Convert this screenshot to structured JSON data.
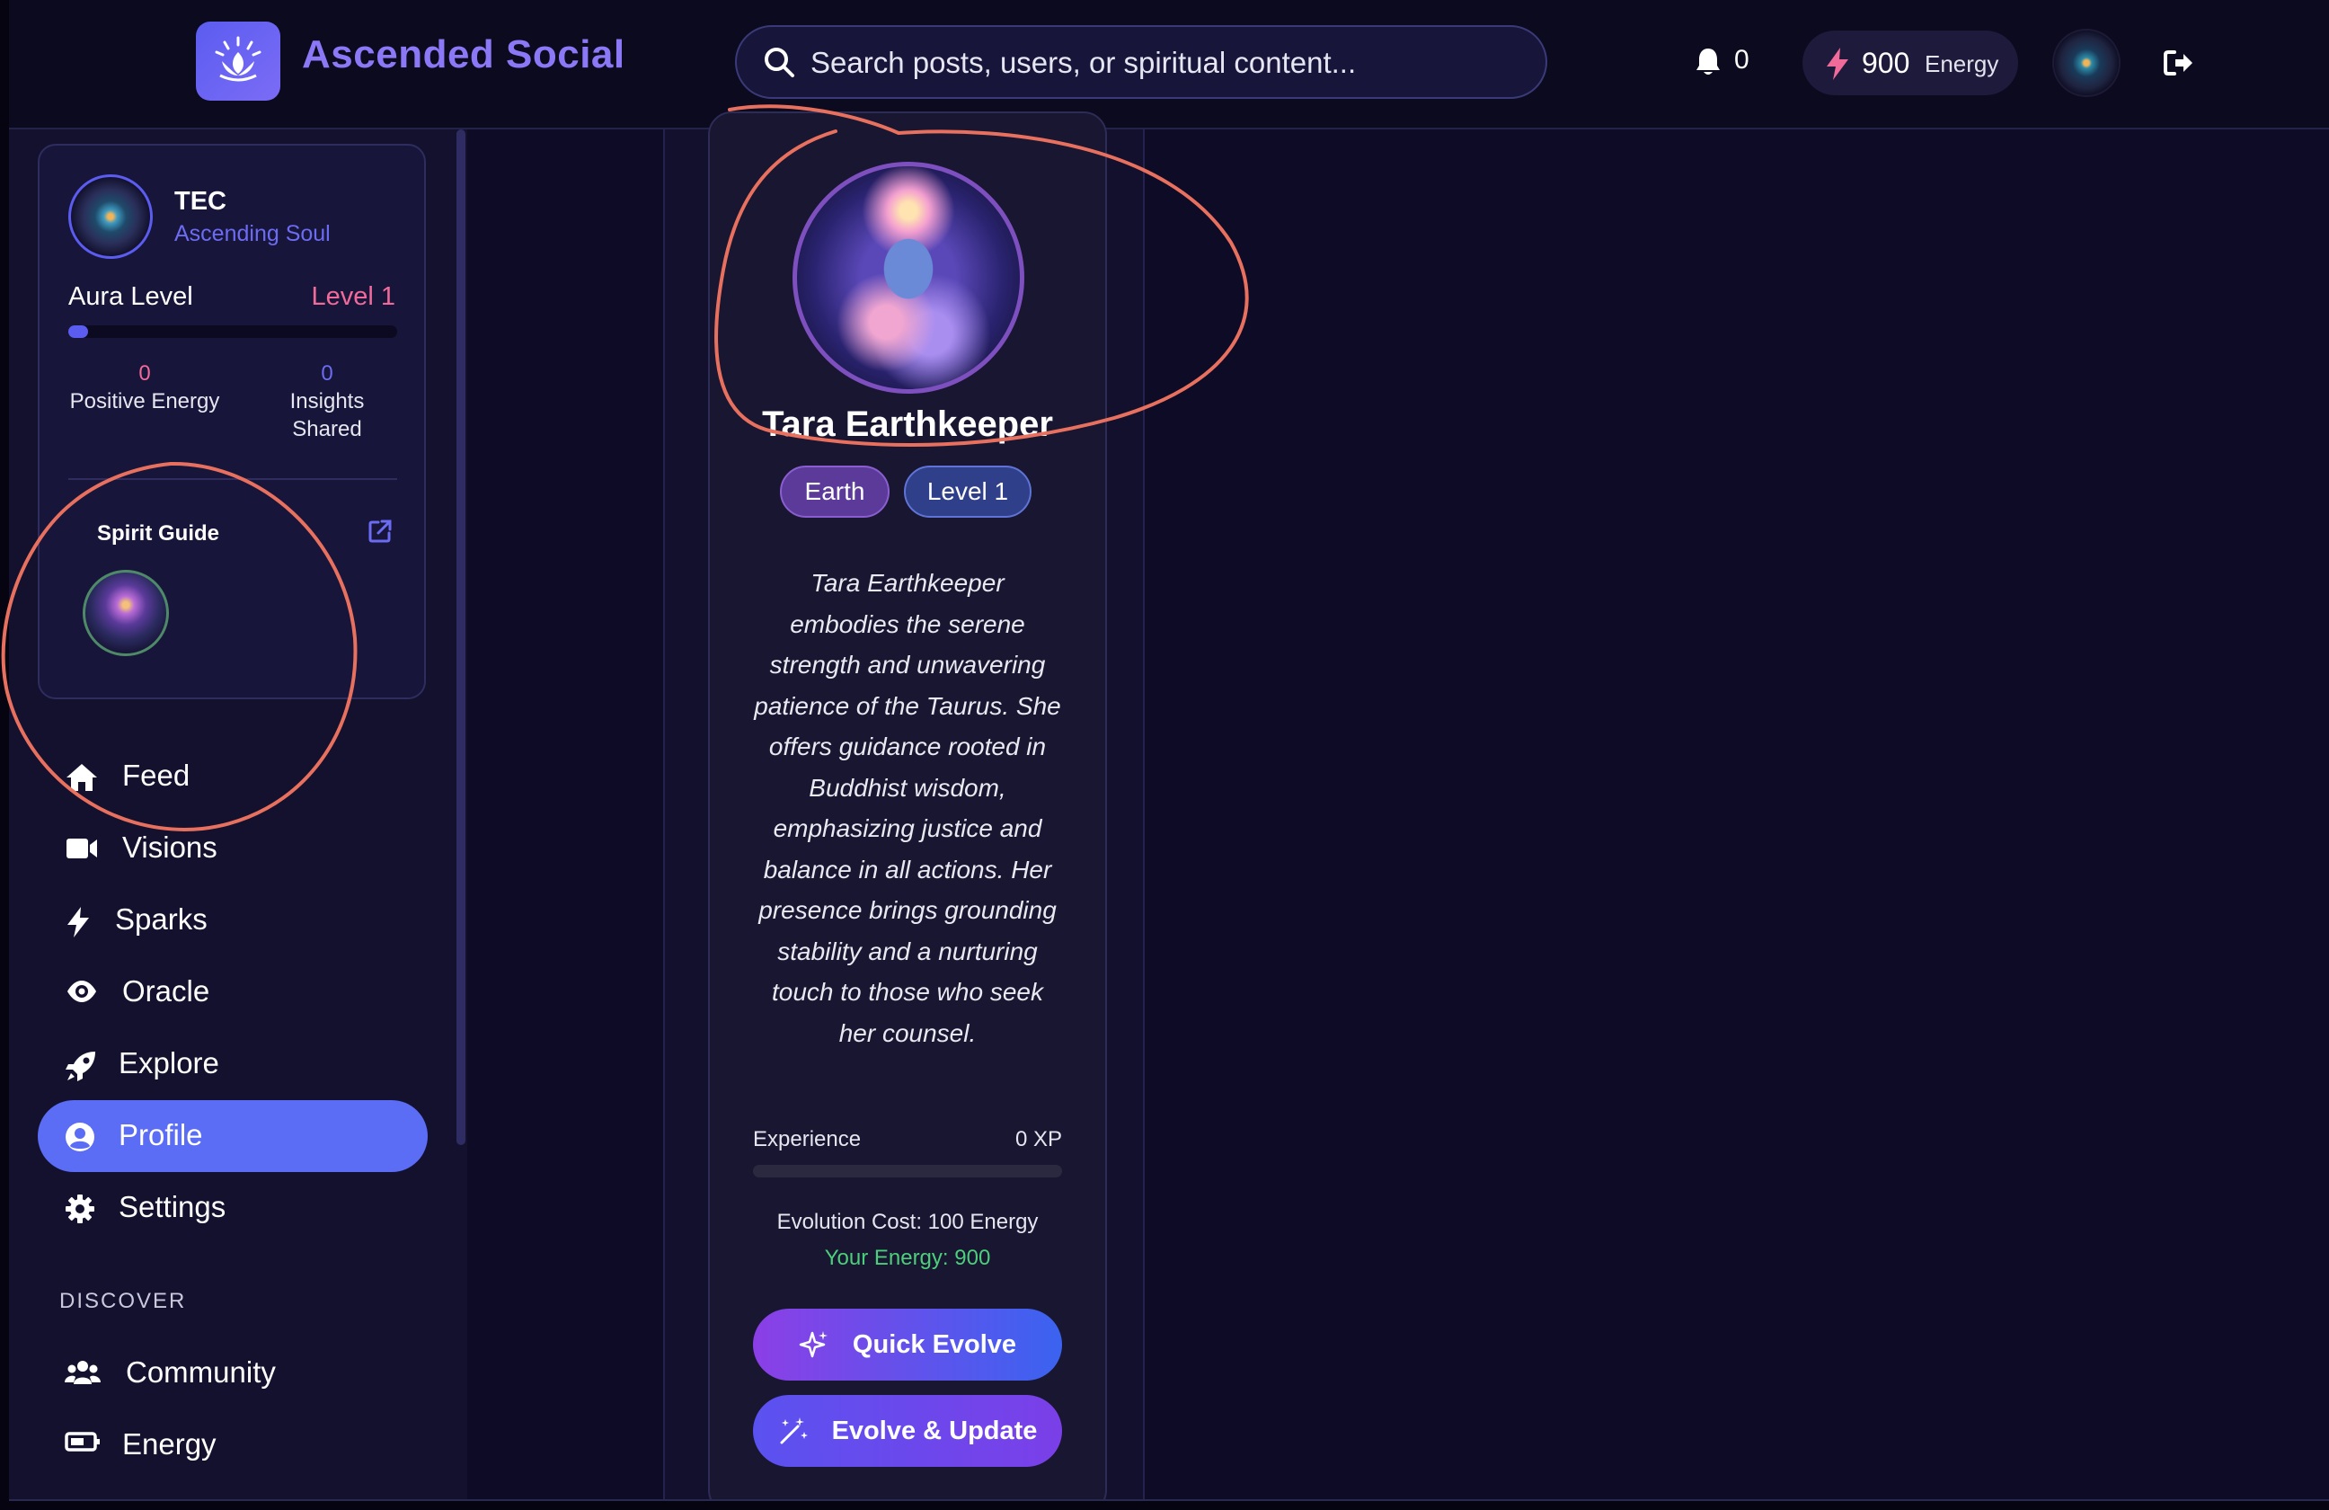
{
  "app": {
    "title": "Ascended Social"
  },
  "header": {
    "search_placeholder": "Search posts, users, or spiritual content...",
    "notification_count": "0",
    "energy_value": "900",
    "energy_label": "Energy"
  },
  "sidebar": {
    "user": {
      "name": "TEC",
      "title": "Ascending Soul"
    },
    "aura": {
      "label": "Aura Level",
      "level": "Level 1",
      "progress": 0.06
    },
    "stats": [
      {
        "value": "0",
        "label": "Positive Energy"
      },
      {
        "value": "0",
        "label": "Insights Shared"
      }
    ],
    "spirit_guide_label": "Spirit Guide",
    "nav": [
      {
        "label": "Feed",
        "icon": "home-icon"
      },
      {
        "label": "Visions",
        "icon": "video-camera-icon"
      },
      {
        "label": "Sparks",
        "icon": "bolt-icon"
      },
      {
        "label": "Oracle",
        "icon": "eye-icon"
      },
      {
        "label": "Explore",
        "icon": "rocket-icon"
      },
      {
        "label": "Profile",
        "icon": "user-circle-icon",
        "active": true
      },
      {
        "label": "Settings",
        "icon": "gear-icon"
      }
    ],
    "discover_label": "DISCOVER",
    "discover": [
      {
        "label": "Community",
        "icon": "users-icon"
      },
      {
        "label": "Energy",
        "icon": "battery-icon"
      }
    ]
  },
  "guide": {
    "name": "Tara Earthkeeper",
    "element": "Earth",
    "level": "Level 1",
    "description": "Tara Earthkeeper embodies the serene strength and unwavering patience of the Taurus. She offers guidance rooted in Buddhist wisdom, emphasizing justice and balance in all actions. Her presence brings grounding stability and a nurturing touch to those who seek her counsel.",
    "experience_label": "Experience",
    "experience_value": "0 XP",
    "experience_progress": 0,
    "evolution_cost": "Evolution Cost: 100 Energy",
    "your_energy": "Your Energy: 900",
    "quick_evolve_label": "Quick Evolve",
    "evolve_update_label": "Evolve & Update"
  },
  "colors": {
    "accent": "#5b5cf0",
    "brand": "#8b78f6",
    "pink": "#f06a9a",
    "green": "#4ccf7a",
    "annotation": "#e8705e"
  }
}
